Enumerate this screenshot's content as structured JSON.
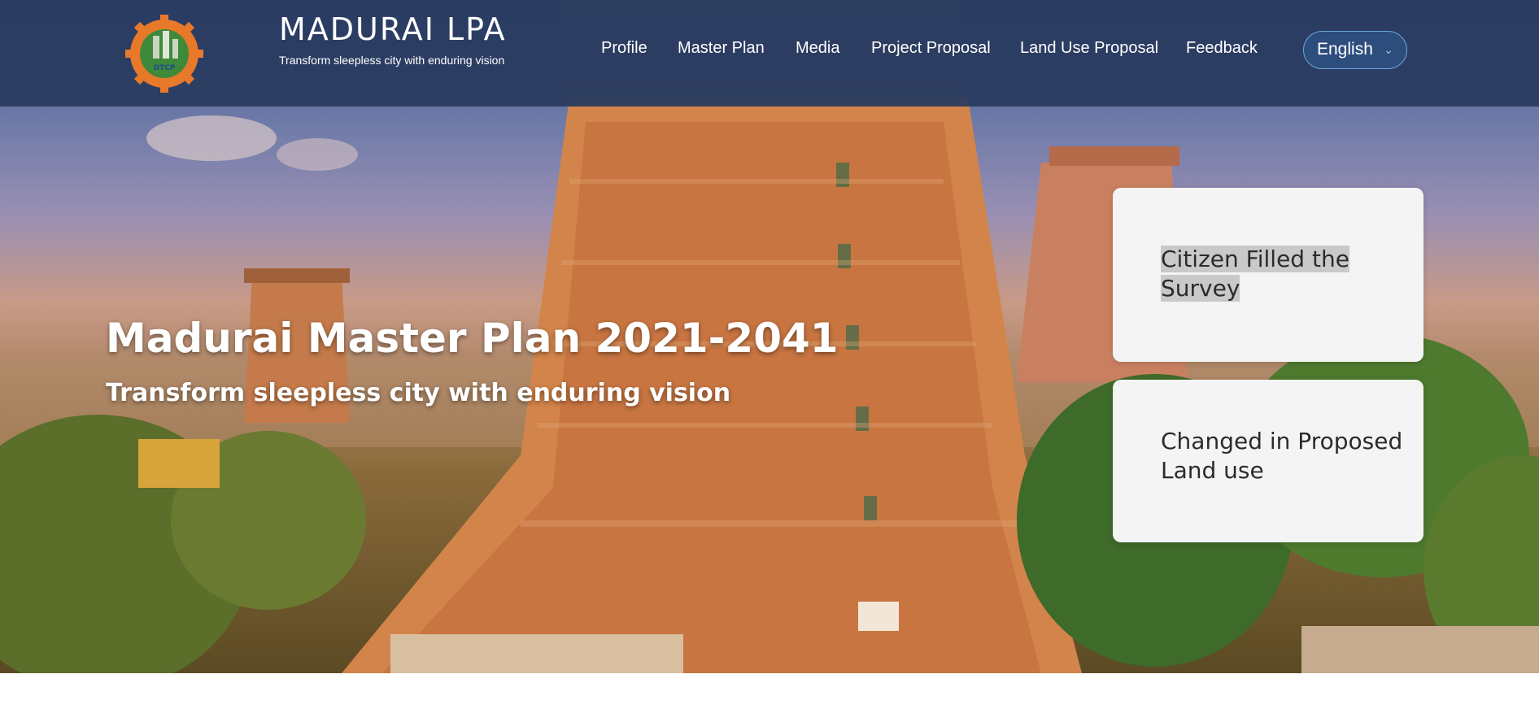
{
  "header": {
    "logo_icon": "dtcp-gear-logo",
    "logo_text": "DTCP",
    "title": "MADURAI LPA",
    "tagline": "Transform sleepless city with enduring vision",
    "bg_color": "#283a5e"
  },
  "nav": {
    "items": [
      {
        "label": "Profile"
      },
      {
        "label": "Master Plan"
      },
      {
        "label": "Media"
      },
      {
        "label": "Project Proposal"
      },
      {
        "label": "Land Use Proposal"
      },
      {
        "label": "Feedback"
      }
    ]
  },
  "language": {
    "selected": "English",
    "icon": "chevron-down-icon",
    "accent": "#6aa7d8"
  },
  "hero": {
    "title": "Madurai Master Plan 2021-2041",
    "subtitle": "Transform sleepless city with enduring vision",
    "background": "meenakshi-temple-gopuram-photo"
  },
  "cards": [
    {
      "label": "Citizen Filled the Survey"
    },
    {
      "label": "Changed in Proposed Land use"
    }
  ]
}
